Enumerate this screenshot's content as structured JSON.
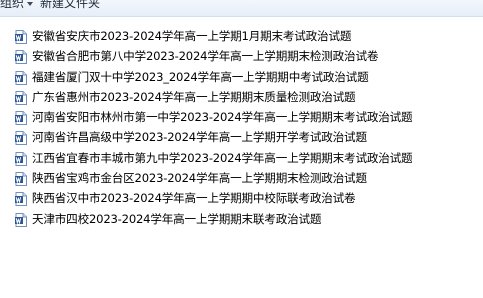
{
  "toolbar": {
    "organize_label": "组织",
    "new_folder_label": "新建文件夹"
  },
  "files": [
    {
      "name": "安徽省安庆市2023-2024学年高一上学期1月期末考试政治试题",
      "icon": "word-document-icon"
    },
    {
      "name": "安徽省合肥市第八中学2023-2024学年高一上学期期末检测政治试卷",
      "icon": "word-document-icon"
    },
    {
      "name": "福建省厦门双十中学2023_2024学年高一上学期期中考试政治试题",
      "icon": "word-document-icon"
    },
    {
      "name": "广东省惠州市2023-2024学年高一上学期期末质量检测政治试题",
      "icon": "word-document-icon"
    },
    {
      "name": "河南省安阳市林州市第一中学2023-2024学年高一上学期期末考试政治试题",
      "icon": "word-document-icon"
    },
    {
      "name": "河南省许昌高级中学2023-2024学年高一上学期开学考试政治试题",
      "icon": "word-document-icon"
    },
    {
      "name": "江西省宜春市丰城市第九中学2023-2024学年高一上学期期末考试政治试题",
      "icon": "word-document-icon"
    },
    {
      "name": "陕西省宝鸡市金台区2023-2024学年高一上学期期末检测政治试题",
      "icon": "word-document-icon"
    },
    {
      "name": "陕西省汉中市2023-2024学年高一上学期期中校际联考政治试卷",
      "icon": "word-document-icon"
    },
    {
      "name": "天津市四校2023-2024学年高一上学期期末联考政治试题",
      "icon": "word-document-icon"
    }
  ],
  "colors": {
    "word_icon_blue": "#2b5797",
    "word_icon_light": "#dbe6f5",
    "toolbar_bg": "#eaf1f9"
  }
}
